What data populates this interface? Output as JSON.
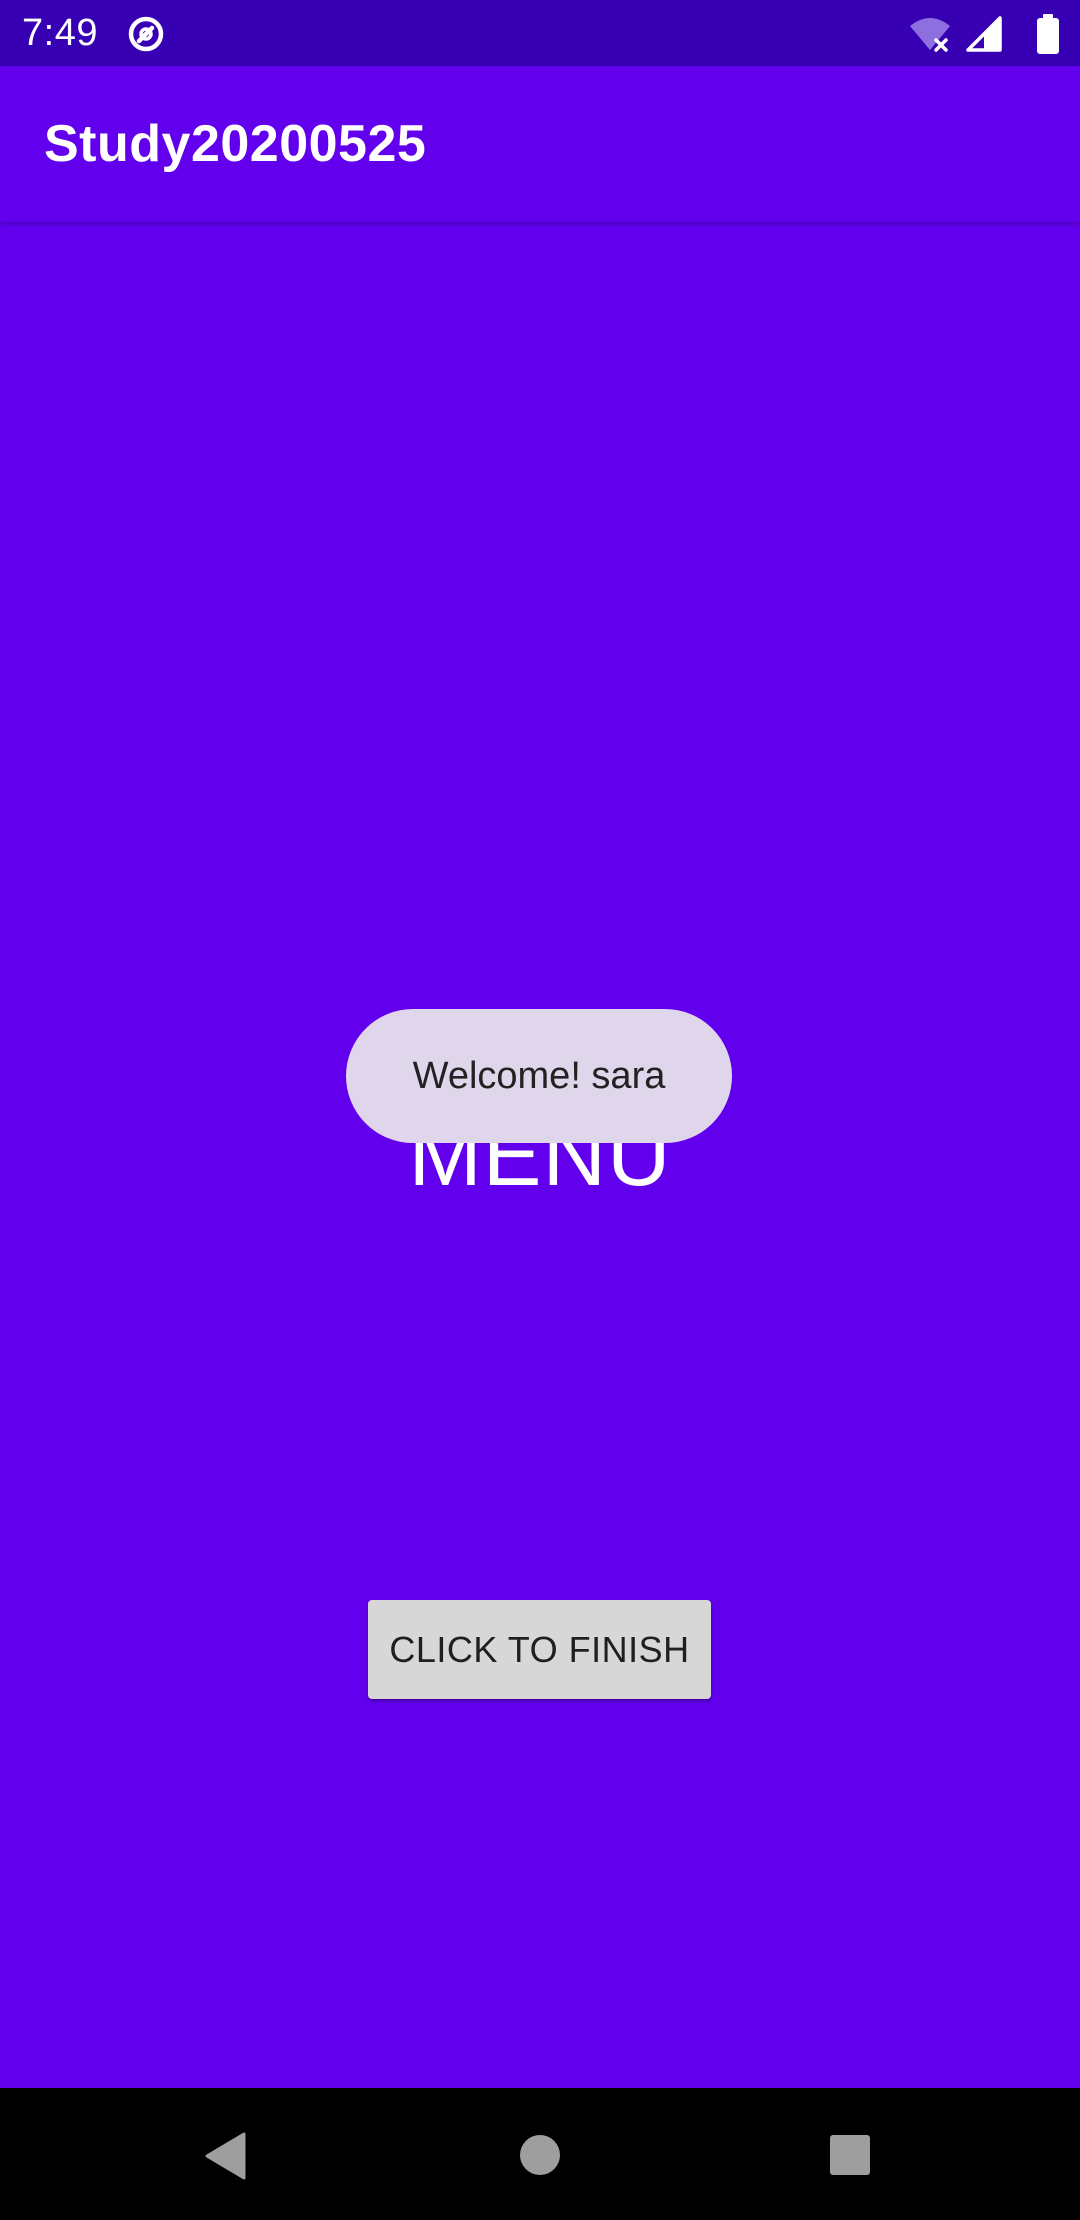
{
  "status_bar": {
    "time": "7:49",
    "icons": [
      "app-notification-icon",
      "wifi-off-icon",
      "cell-signal-icon",
      "battery-full-icon"
    ]
  },
  "app_bar": {
    "title": "Study20200525"
  },
  "content": {
    "menu_label": "MENU",
    "finish_button_label": "CLICK TO FINISH"
  },
  "toast": {
    "message": "Welcome! sara"
  },
  "nav_bar": {
    "icons": [
      "back-icon",
      "home-icon",
      "recents-icon"
    ]
  },
  "colors": {
    "primary": "#6200EE",
    "primary_dark": "#3700B3",
    "toast_bg": "#E0D6EC",
    "button_bg": "#D7D7D7"
  }
}
